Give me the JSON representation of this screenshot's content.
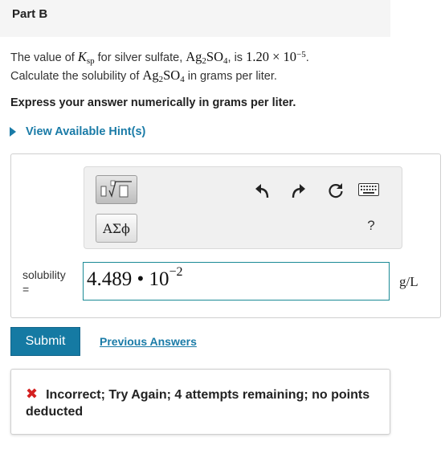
{
  "part": {
    "title": "Part B"
  },
  "question": {
    "prefix": "The value of ",
    "ksp_base": "K",
    "ksp_sub": "sp",
    "mid1": " for silver sulfate, ",
    "formula_ag": "Ag",
    "formula_ag_sub": "2",
    "formula_so": "SO",
    "formula_so_sub": "4",
    "mid2": ", is ",
    "value_coef": "1.20 × 10",
    "value_exp": "−5",
    "end1": ".",
    "line2_prefix": "Calculate the solubility of ",
    "line2_suffix": " in grams per liter."
  },
  "instruction": "Express your answer numerically in grams per liter.",
  "hints": {
    "label": "View Available Hint(s)"
  },
  "toolbar": {
    "greek_label": "ΑΣϕ",
    "help_label": "?",
    "icons": [
      "templates-icon",
      "undo-icon",
      "redo-icon",
      "reset-icon",
      "keyboard-icon",
      "help-icon"
    ]
  },
  "answer": {
    "label_line1": "solubility",
    "label_line2": "=",
    "value_mantissa": "4.489 • 10",
    "value_exp": "−2",
    "unit": "g/L"
  },
  "actions": {
    "submit_label": "Submit",
    "previous_label": "Previous Answers"
  },
  "feedback": {
    "icon": "x-icon",
    "message": "Incorrect; Try Again; 4 attempts remaining; no points deducted",
    "color_icon": "#d42020"
  },
  "colors": {
    "accent": "#157aa3",
    "link": "#1a7ba7",
    "input_border": "#1a8a95"
  }
}
